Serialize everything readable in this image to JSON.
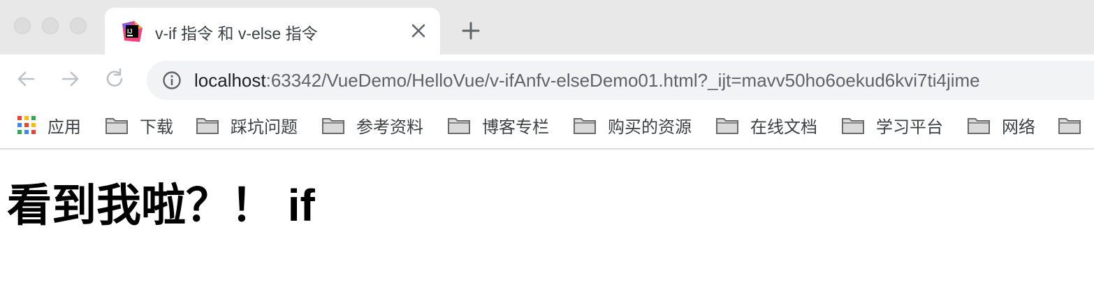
{
  "tab": {
    "title": "v-if 指令 和 v-else 指令",
    "favicon_text": "IJ"
  },
  "address_bar": {
    "host": "localhost",
    "path": ":63342/VueDemo/HelloVue/v-ifAnfv-elseDemo01.html?_ijt=mavv50ho6oekud6kvi7ti4jime"
  },
  "bookmarks": {
    "apps_label": "应用",
    "items": [
      "下载",
      "踩坑问题",
      "参考资料",
      "博客专栏",
      "购买的资源",
      "在线文档",
      "学习平台",
      "网络"
    ]
  },
  "page": {
    "heading": "看到我啦？！ if"
  },
  "colors": {
    "tab_strip": "#e8e8e8",
    "omnibox": "#f1f3f4",
    "icon_gray": "#5f6368"
  }
}
